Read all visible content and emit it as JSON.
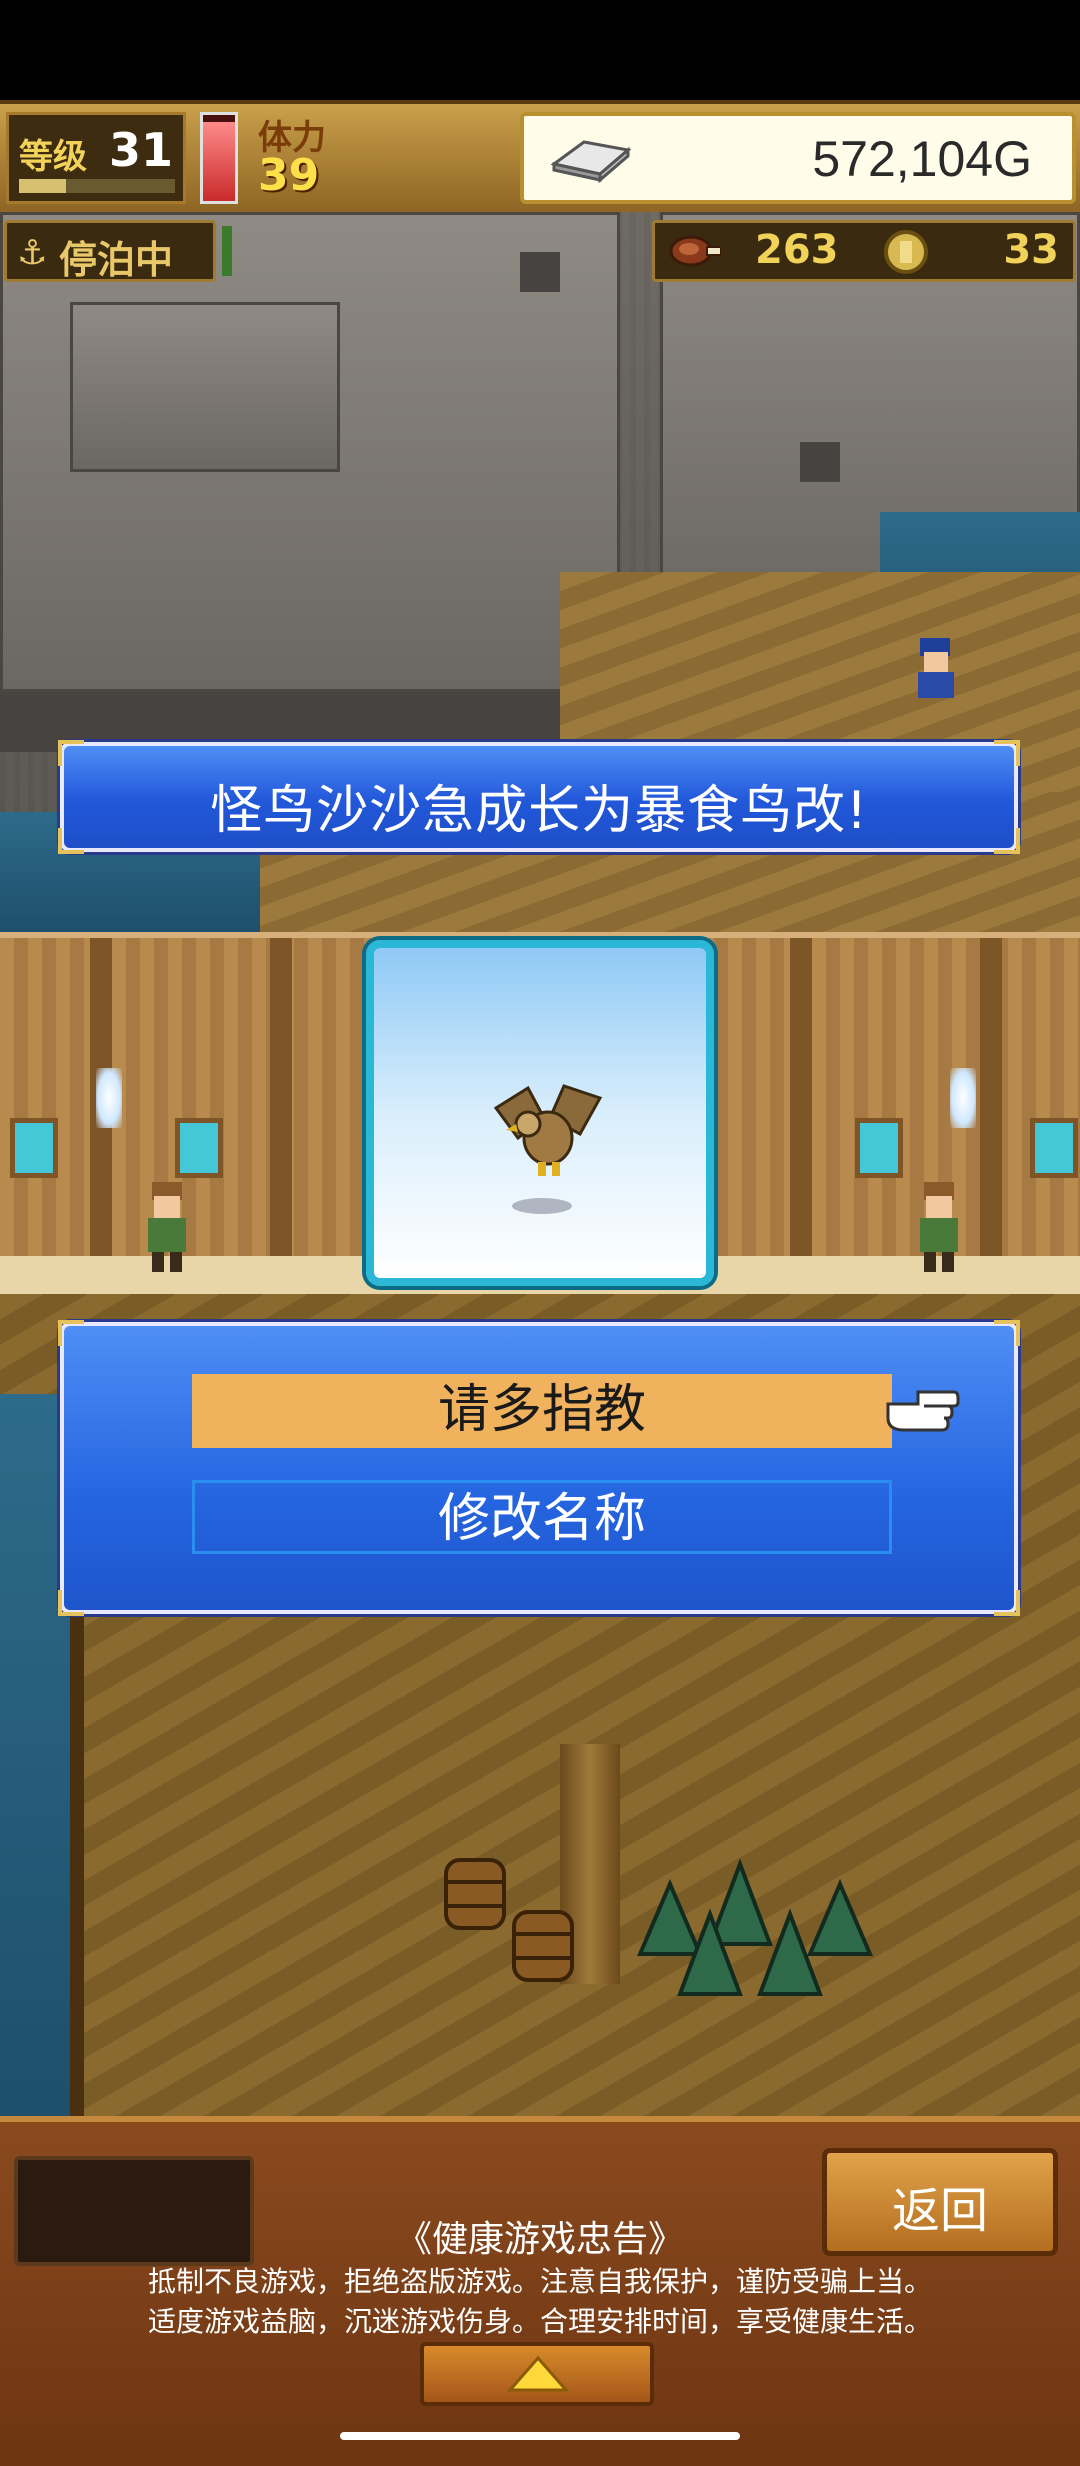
{
  "status_bar": {
    "level_label": "等级",
    "level_value": "31",
    "level_progress": 0.3,
    "stamina_label": "体力",
    "stamina_value": "39",
    "stamina_fill": 0.92,
    "money": "572,104G"
  },
  "hud": {
    "anchor_icon": "anchor-icon",
    "anchor_status": "停泊中",
    "food_value": "263",
    "medal_value": "33"
  },
  "message": {
    "text": "怪鸟沙沙急成长为暴食鸟改!"
  },
  "choices": [
    {
      "label": "请多指教",
      "selected": true
    },
    {
      "label": "修改名称",
      "selected": false
    }
  ],
  "footer": {
    "back_label": "返回",
    "notice_title": "《健康游戏忠告》",
    "notice_line_1": "抵制不良游戏，拒绝盗版游戏。注意自我保护，谨防受骗上当。",
    "notice_line_2": "适度游戏益脑，沉迷游戏伤身。合理安排时间，享受健康生活。"
  },
  "colors": {
    "accent_gold": "#f2d35a",
    "menu_blue": "#2565e0",
    "selected_orange": "#f0b25c",
    "frame_cyan": "#2bb8d6"
  }
}
